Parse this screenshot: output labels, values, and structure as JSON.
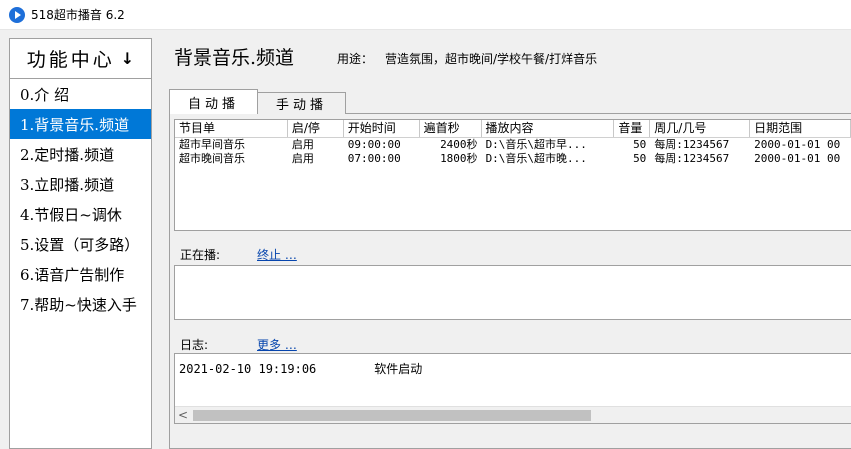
{
  "window": {
    "title": "518超市播音 6.2"
  },
  "sidebar": {
    "header": "功能中心",
    "header_arrow": "↓",
    "items": [
      {
        "label": "0.介 绍"
      },
      {
        "label": "1.背景音乐.频道"
      },
      {
        "label": "2.定时播.频道"
      },
      {
        "label": "3.立即播.频道"
      },
      {
        "label": "4.节假日~调休"
      },
      {
        "label": "5.设置（可多路）"
      },
      {
        "label": "6.语音广告制作"
      },
      {
        "label": "7.帮助~快速入手"
      }
    ]
  },
  "main": {
    "title": "背景音乐.频道",
    "usage_label": "用途：",
    "usage_text": "营造氛围，超市晚间/学校午餐/打烊音乐",
    "tabs": [
      {
        "label": "自动播"
      },
      {
        "label": "手动播"
      }
    ]
  },
  "table": {
    "headers": [
      "节目单",
      "启/停",
      "开始时间",
      "遍首秒",
      "播放内容",
      "音量",
      "周几/几号",
      "日期范围"
    ],
    "rows": [
      [
        "超市早间音乐",
        "启用",
        "09:00:00",
        "2400秒",
        "D:\\音乐\\超市早...",
        "50",
        "每周:1234567",
        "2000-01-01 00"
      ],
      [
        "超市晚间音乐",
        "启用",
        "07:00:00",
        "1800秒",
        "D:\\音乐\\超市晚...",
        "50",
        "每周:1234567",
        "2000-01-01 00"
      ]
    ]
  },
  "now_playing": {
    "label": "正在播:",
    "link": "终止 …"
  },
  "log": {
    "label": "日志:",
    "link": "更多 …",
    "entries": [
      {
        "time": "2021-02-10 19:19:06",
        "message": "软件启动"
      }
    ],
    "scroll_left": "<"
  }
}
